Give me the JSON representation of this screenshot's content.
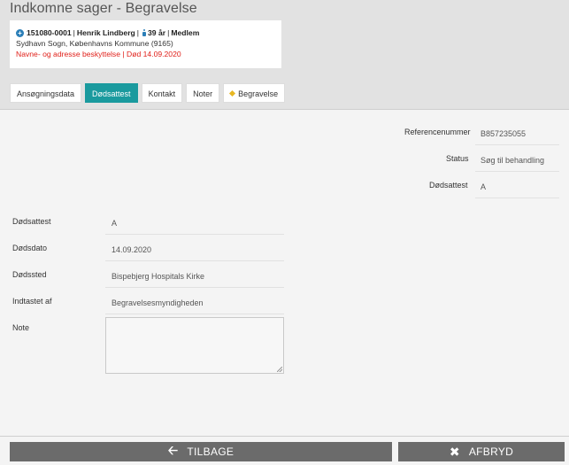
{
  "header": {
    "title": "Indkomne sager - Begravelse"
  },
  "person": {
    "id": "151080-0001",
    "name": "Henrik Lindberg",
    "age": "39 år",
    "membership": "Medlem",
    "sep": "|",
    "parish": "Sydhavn Sogn, Københavns Kommune (9165)",
    "warning": "Navne- og adresse beskyttelse | Død 14.09.2020"
  },
  "tabs": [
    {
      "label": "Ansøgningsdata"
    },
    {
      "label": "Dødsattest"
    },
    {
      "label": "Kontakt"
    },
    {
      "label": "Noter"
    },
    {
      "label": "Begravelse"
    }
  ],
  "summary": {
    "reference_label": "Referencenummer",
    "reference_value": "B857235055",
    "status_label": "Status",
    "status_value": "Søg til behandling",
    "certificate_label": "Dødsattest",
    "certificate_value": "A"
  },
  "form": {
    "certificate_label": "Dødsattest",
    "certificate_value": "A",
    "date_label": "Dødsdato",
    "date_value": "14.09.2020",
    "place_label": "Dødssted",
    "place_value": "Bispebjerg Hospitals Kirke",
    "entered_by_label": "Indtastet af",
    "entered_by_value": "Begravelsesmyndigheden",
    "note_label": "Note",
    "note_value": ""
  },
  "footer": {
    "back_label": "TILBAGE",
    "cancel_label": "AFBRYD"
  },
  "colors": {
    "accent": "#1a9a9e",
    "warning": "#e0201a",
    "button": "#6b6b6b"
  },
  "icons": {
    "add": "plus-circle-icon",
    "person": "person-icon",
    "back": "arrow-left-icon",
    "cancel": "close-icon",
    "tab_marker": "diamond-icon"
  }
}
